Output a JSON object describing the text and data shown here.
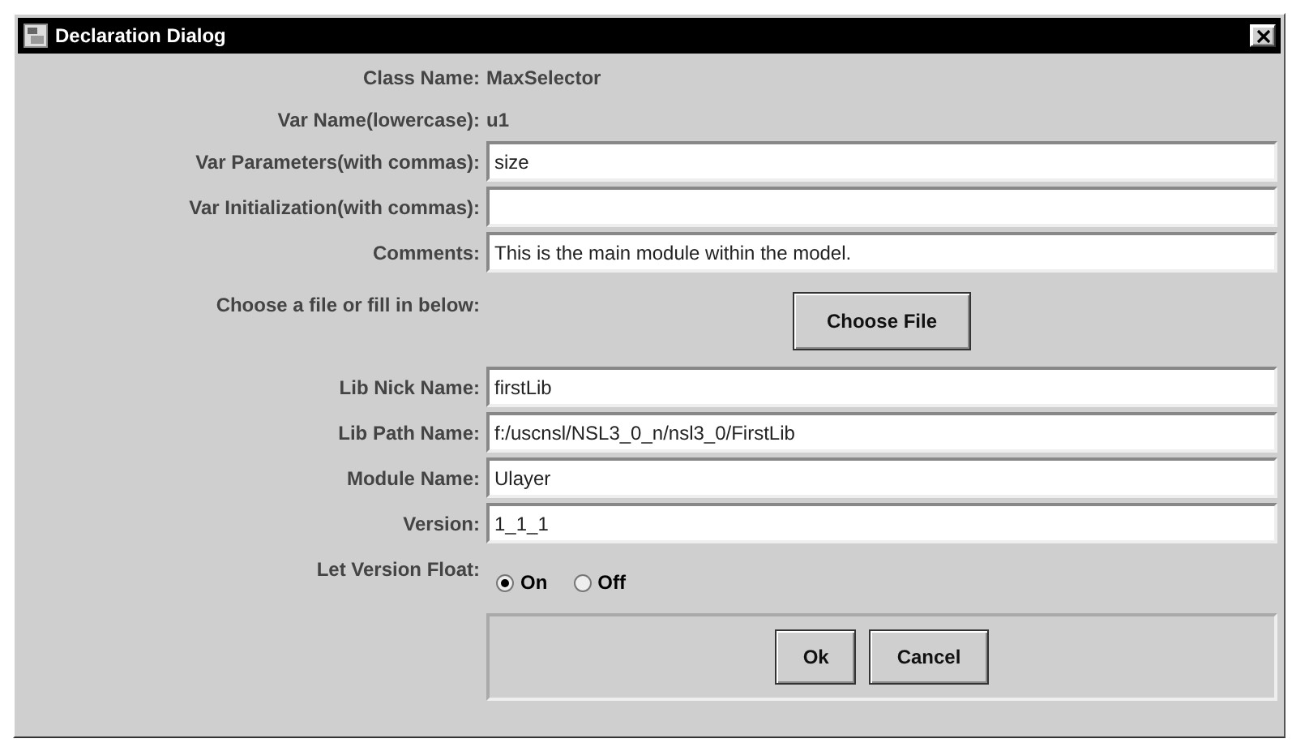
{
  "window": {
    "title": "Declaration Dialog"
  },
  "info": [
    {
      "label": "Class Name:",
      "value": "MaxSelector"
    },
    {
      "label": "Var Name(lowercase):",
      "value": "u1"
    }
  ],
  "fields": [
    {
      "label": "Var Parameters(with commas):",
      "value": "size"
    },
    {
      "label": "Var Initialization(with commas):"
    },
    {
      "label": "Comments:",
      "value": "This is the main module within the model."
    }
  ],
  "file_choice": {
    "label": "Choose a file or fill in below:",
    "button": "Choose File"
  },
  "lib_fields": [
    {
      "label": "Lib Nick Name:",
      "value": "firstLib"
    },
    {
      "label": "Lib Path Name:",
      "value": "f:/uscnsl/NSL3_0_n/nsl3_0/FirstLib"
    },
    {
      "label": "Module Name:",
      "value": "Ulayer"
    },
    {
      "label": "Version:",
      "value": "1_1_1"
    }
  ],
  "version_float": {
    "label": "Let Version Float:",
    "options": [
      {
        "label": "On",
        "selected": true
      },
      {
        "label": "Off",
        "selected": false
      }
    ]
  },
  "buttons": [
    "Ok",
    "Cancel"
  ]
}
